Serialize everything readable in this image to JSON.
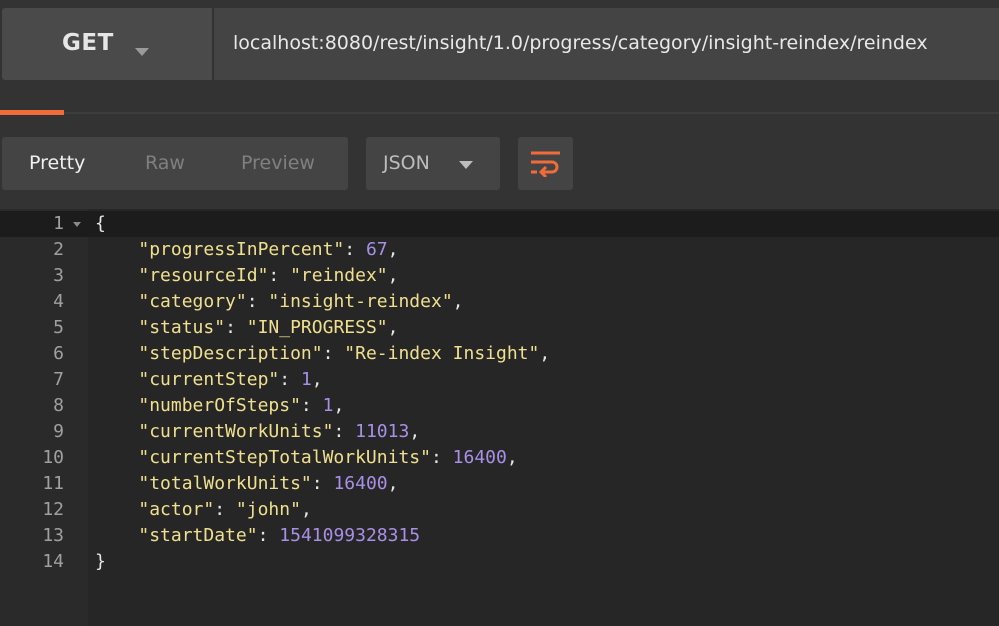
{
  "request": {
    "method": "GET",
    "url": "localhost:8080/rest/insight/1.0/progress/category/insight-reindex/reindex"
  },
  "response_toolbar": {
    "tabs": [
      "Pretty",
      "Raw",
      "Preview"
    ],
    "active_tab": "Pretty",
    "format": "JSON",
    "wrap_icon": "wrap-lines-icon"
  },
  "colors": {
    "accent": "#f26b3a",
    "json_key": "#efe08f",
    "json_string": "#efe08f",
    "json_number": "#a98fe6"
  },
  "code": {
    "open_brace": "{",
    "close_brace": "}",
    "line_numbers": [
      "1",
      "2",
      "3",
      "4",
      "5",
      "6",
      "7",
      "8",
      "9",
      "10",
      "11",
      "12",
      "13",
      "14"
    ],
    "entries": [
      {
        "key": "\"progressInPercent\"",
        "value": "67",
        "type": "number",
        "trail": ","
      },
      {
        "key": "\"resourceId\"",
        "value": "\"reindex\"",
        "type": "string",
        "trail": ","
      },
      {
        "key": "\"category\"",
        "value": "\"insight-reindex\"",
        "type": "string",
        "trail": ","
      },
      {
        "key": "\"status\"",
        "value": "\"IN_PROGRESS\"",
        "type": "string",
        "trail": ","
      },
      {
        "key": "\"stepDescription\"",
        "value": "\"Re-index Insight\"",
        "type": "string",
        "trail": ","
      },
      {
        "key": "\"currentStep\"",
        "value": "1",
        "type": "number",
        "trail": ","
      },
      {
        "key": "\"numberOfSteps\"",
        "value": "1",
        "type": "number",
        "trail": ","
      },
      {
        "key": "\"currentWorkUnits\"",
        "value": "11013",
        "type": "number",
        "trail": ","
      },
      {
        "key": "\"currentStepTotalWorkUnits\"",
        "value": "16400",
        "type": "number",
        "trail": ","
      },
      {
        "key": "\"totalWorkUnits\"",
        "value": "16400",
        "type": "number",
        "trail": ","
      },
      {
        "key": "\"actor\"",
        "value": "\"john\"",
        "type": "string",
        "trail": ","
      },
      {
        "key": "\"startDate\"",
        "value": "1541099328315",
        "type": "number",
        "trail": ""
      }
    ]
  }
}
